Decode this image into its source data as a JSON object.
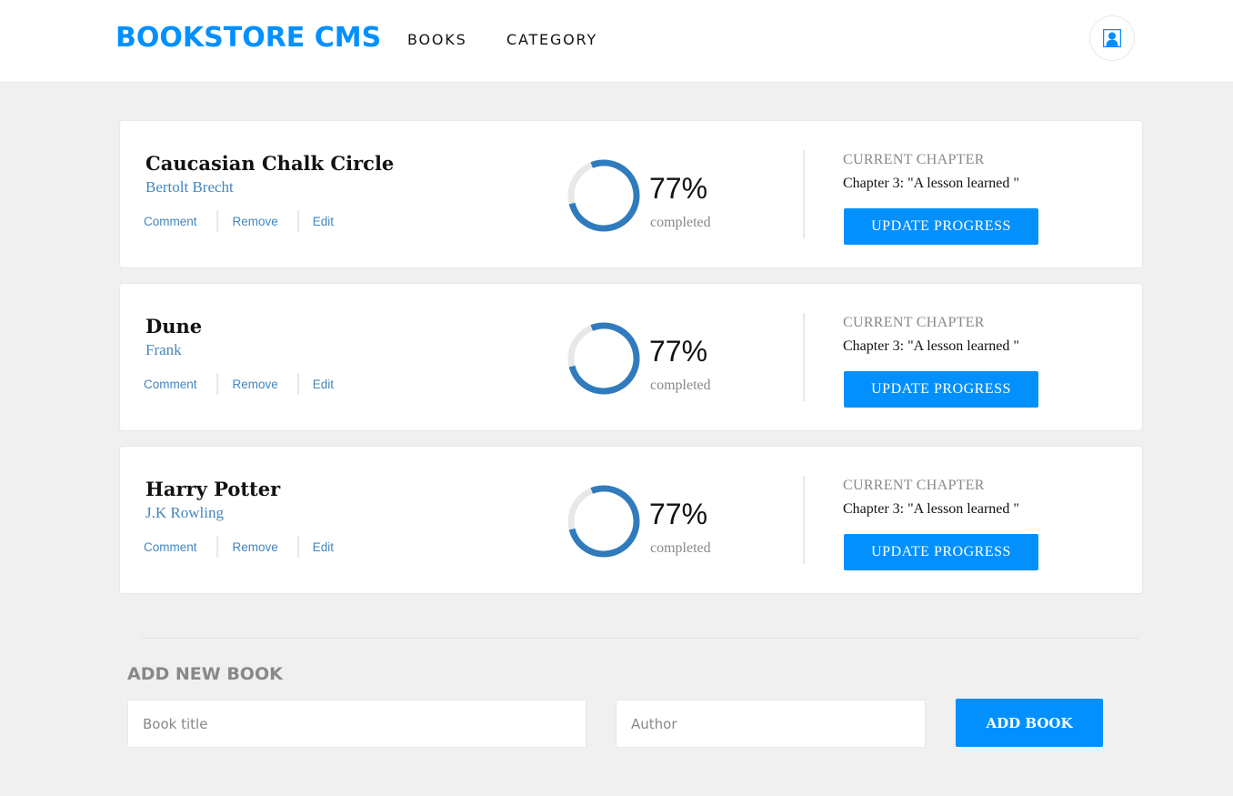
{
  "header": {
    "logo": "BOOKSTORE CMS",
    "nav": [
      "BOOKS",
      "CATEGORY"
    ],
    "user_icon": "user-icon"
  },
  "colors": {
    "accent": "#0290ff",
    "author_link": "#4386bf",
    "ring_track": "#e8e8e8",
    "ring_fill": "#307bbe"
  },
  "books": [
    {
      "title": "Caucasian Chalk Circle",
      "author": "Bertolt Brecht",
      "actions": [
        "Comment",
        "Remove",
        "Edit"
      ],
      "progress_pct": 77,
      "progress_text": "77%",
      "completed_label": "completed",
      "chapter_heading": "CURRENT CHAPTER",
      "chapter": "Chapter 3: \"A lesson learned \"",
      "update_label": "UPDATE PROGRESS"
    },
    {
      "title": "Dune",
      "author": "Frank",
      "actions": [
        "Comment",
        "Remove",
        "Edit"
      ],
      "progress_pct": 77,
      "progress_text": "77%",
      "completed_label": "completed",
      "chapter_heading": "CURRENT CHAPTER",
      "chapter": "Chapter 3: \"A lesson learned \"",
      "update_label": "UPDATE PROGRESS"
    },
    {
      "title": "Harry Potter",
      "author": "J.K Rowling",
      "actions": [
        "Comment",
        "Remove",
        "Edit"
      ],
      "progress_pct": 77,
      "progress_text": "77%",
      "completed_label": "completed",
      "chapter_heading": "CURRENT CHAPTER",
      "chapter": "Chapter 3: \"A lesson learned \"",
      "update_label": "UPDATE PROGRESS"
    }
  ],
  "add_form": {
    "title": "ADD NEW BOOK",
    "title_placeholder": "Book title",
    "author_placeholder": "Author",
    "submit_label": "ADD BOOK"
  }
}
